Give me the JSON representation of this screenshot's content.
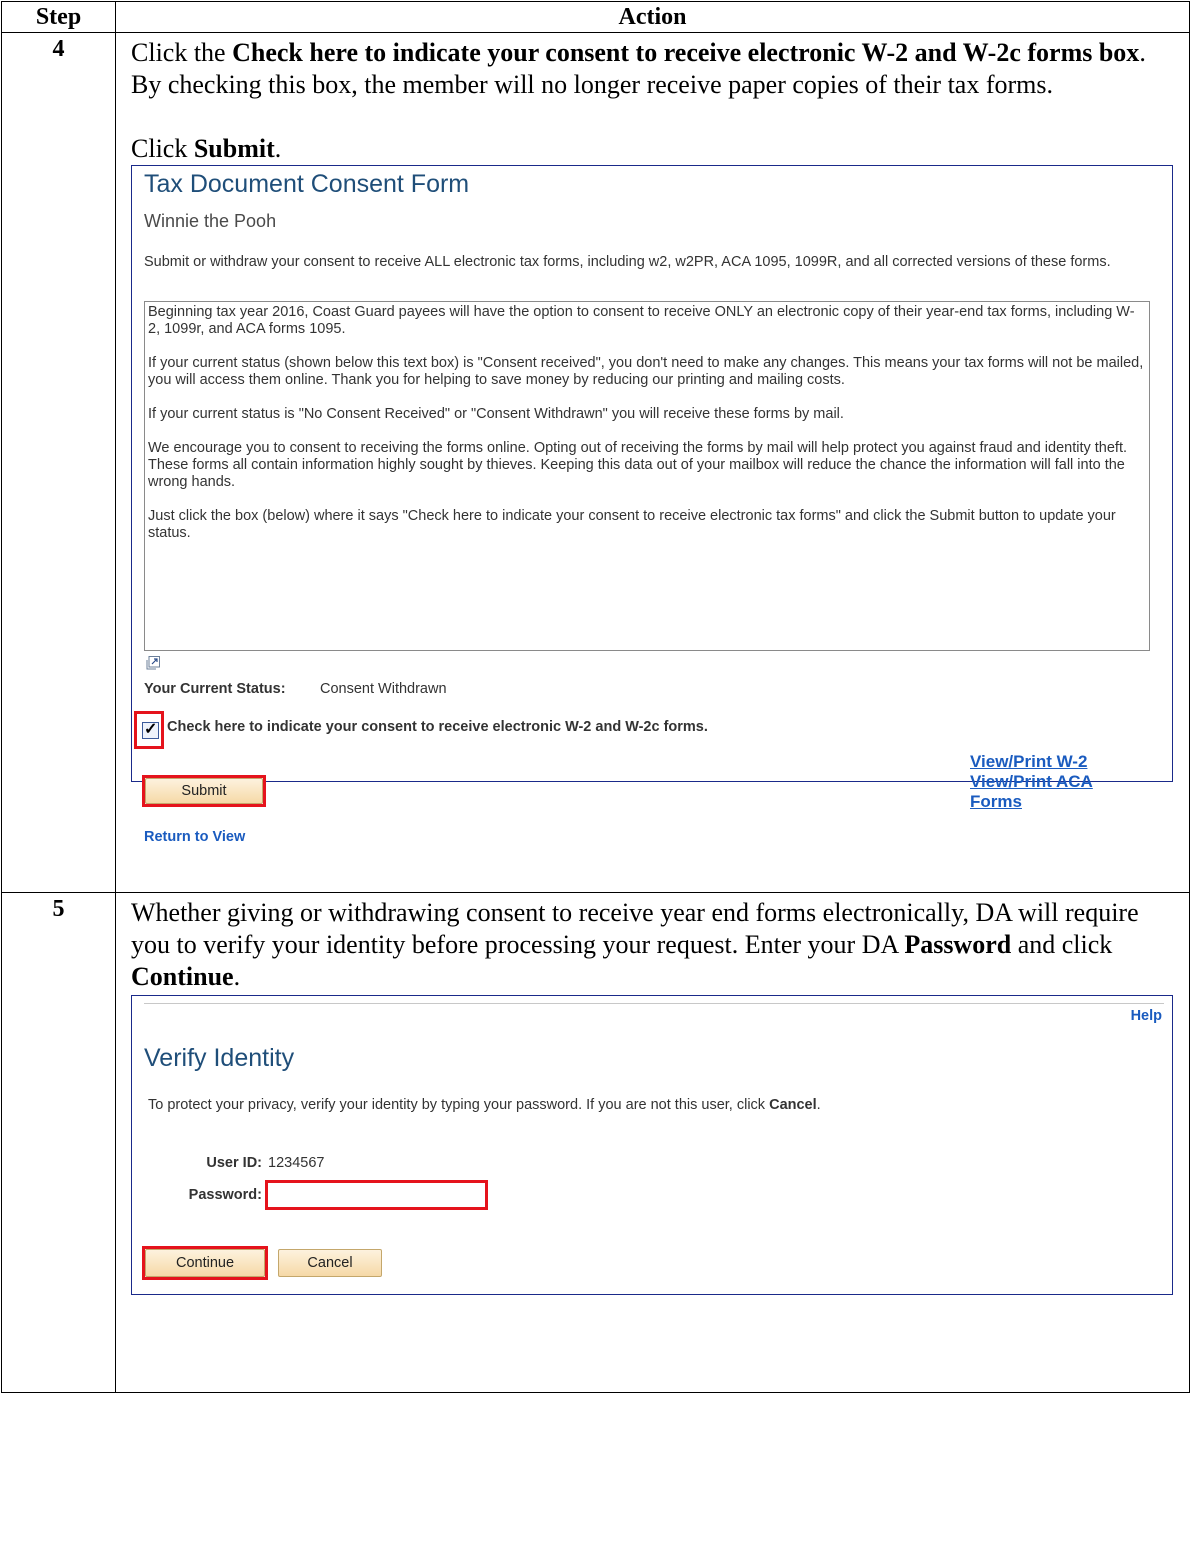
{
  "table": {
    "header_step": "Step",
    "header_action": "Action"
  },
  "step4": {
    "number": "4",
    "line1_pre": "Click the ",
    "line1_bold": "Check here to indicate your consent to receive electronic W-2 and W-2c forms box",
    "line1_post": ".  By checking this box, the member will no longer receive paper copies of their tax forms.",
    "line2_pre": "Click ",
    "line2_bold": "Submit",
    "line2_post": ".",
    "panel": {
      "title": "Tax Document Consent Form",
      "name": "Winnie the Pooh",
      "intro": "Submit or withdraw your consent to receive ALL electronic tax forms, including w2, w2PR, ACA 1095, 1099R, and all corrected versions of these forms.",
      "paragraphs": [
        "Beginning tax year 2016, Coast Guard payees will have the option to consent to receive ONLY an electronic copy of their year-end tax forms, including W-2, 1099r, and ACA forms 1095.",
        "If your current status (shown below this text box) is \"Consent received\", you don't need to make any changes. This means your tax forms will not be mailed, you will access them online. Thank you for helping to save money by reducing our printing and mailing costs.",
        "If your current status is \"No Consent Received\" or  \"Consent Withdrawn\" you will receive these forms by mail.",
        "We encourage you to consent to receiving the forms online. Opting out of receiving the forms by mail will help protect you against fraud and identity theft. These forms all contain information highly sought by thieves. Keeping this data out of your mailbox will reduce the chance the information will fall into the wrong hands.",
        "Just click the box (below) where it says \"Check here to indicate your consent to receive electronic tax forms\" and click the Submit button to update your status."
      ],
      "status_label": "Your Current Status:",
      "status_value": "Consent Withdrawn",
      "consent_checked": true,
      "consent_text": "Check here to indicate your consent to receive electronic W-2 and W-2c forms.",
      "link_w2": "View/Print W-2",
      "link_aca_1": "View/Print ACA",
      "link_aca_2": "Forms",
      "submit_label": "Submit",
      "return_label": "Return to View"
    }
  },
  "step5": {
    "number": "5",
    "line1": "Whether giving or withdrawing consent to receive year end forms electronically, DA will require you to verify your identity before processing your request. Enter your DA ",
    "bold_password": "Password",
    "mid": " and click ",
    "bold_continue": "Continue",
    "end": ".",
    "panel": {
      "help": "Help",
      "title": "Verify Identity",
      "text_pre": "To protect your privacy, verify your identity by typing your password. If you are not this user, click ",
      "text_bold": "Cancel",
      "text_post": ".",
      "userid_label": "User ID:",
      "userid_value": "1234567",
      "password_label": "Password:",
      "password_value": "",
      "continue_label": "Continue",
      "cancel_label": "Cancel"
    }
  },
  "colors": {
    "highlight": "#e5131c",
    "link": "#1a5bbf",
    "title": "#1f4e79",
    "button": "#f6d9a7"
  }
}
